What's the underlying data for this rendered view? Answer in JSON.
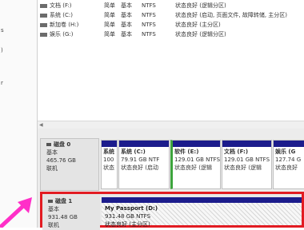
{
  "left_strip": [
    "",
    "",
    "",
    "",
    "",
    "",
    ""
  ],
  "volumes": [
    {
      "name": "文档 (F:)",
      "layout": "简单",
      "type": "基本",
      "fs": "NTFS",
      "status": "状态良好 (逻辑分区)"
    },
    {
      "name": "系统 (C:)",
      "layout": "简单",
      "type": "基本",
      "fs": "NTFS",
      "status": "状态良好 (启动, 页面文件, 故障转储, 主分区)"
    },
    {
      "name": "新加卷 (H:)",
      "layout": "简单",
      "type": "基本",
      "fs": "NTFS",
      "status": "状态良好 (主分区)"
    },
    {
      "name": "娱乐 (G:)",
      "layout": "简单",
      "type": "基本",
      "fs": "NTFS",
      "status": "状态良好 (逻辑分区)"
    }
  ],
  "disk0": {
    "title": "磁盘 0",
    "type": "基本",
    "size": "465.76 GB",
    "state": "联机",
    "partitions": [
      {
        "name": "系统",
        "size": "100",
        "status": "状态"
      },
      {
        "name": "系统  (C:)",
        "size": "79.91 GB NTF",
        "status": "状态良好 (启动"
      },
      {
        "name": "软件  (E:)",
        "size": "129.01 GB NTFS",
        "status": "状态良好 (逻辑"
      },
      {
        "name": "文档  (F:)",
        "size": "129.01 GB NTFS",
        "status": "状态良好 (逻辑"
      },
      {
        "name": "娱乐  (G",
        "size": "127.74 G",
        "status": "状态良好"
      }
    ]
  },
  "disk1": {
    "title": "磁盘 1",
    "type": "基本",
    "size": "931.48 GB",
    "state": "联机",
    "volume": {
      "name": "My Passport  (D:)",
      "size": "931.48 GB NTFS",
      "status": "状态良好 (主分区)"
    }
  },
  "colors": {
    "partition_bar": "#1c1c8c",
    "highlight": "#e21b22",
    "arrow": "#ff2fc8"
  }
}
